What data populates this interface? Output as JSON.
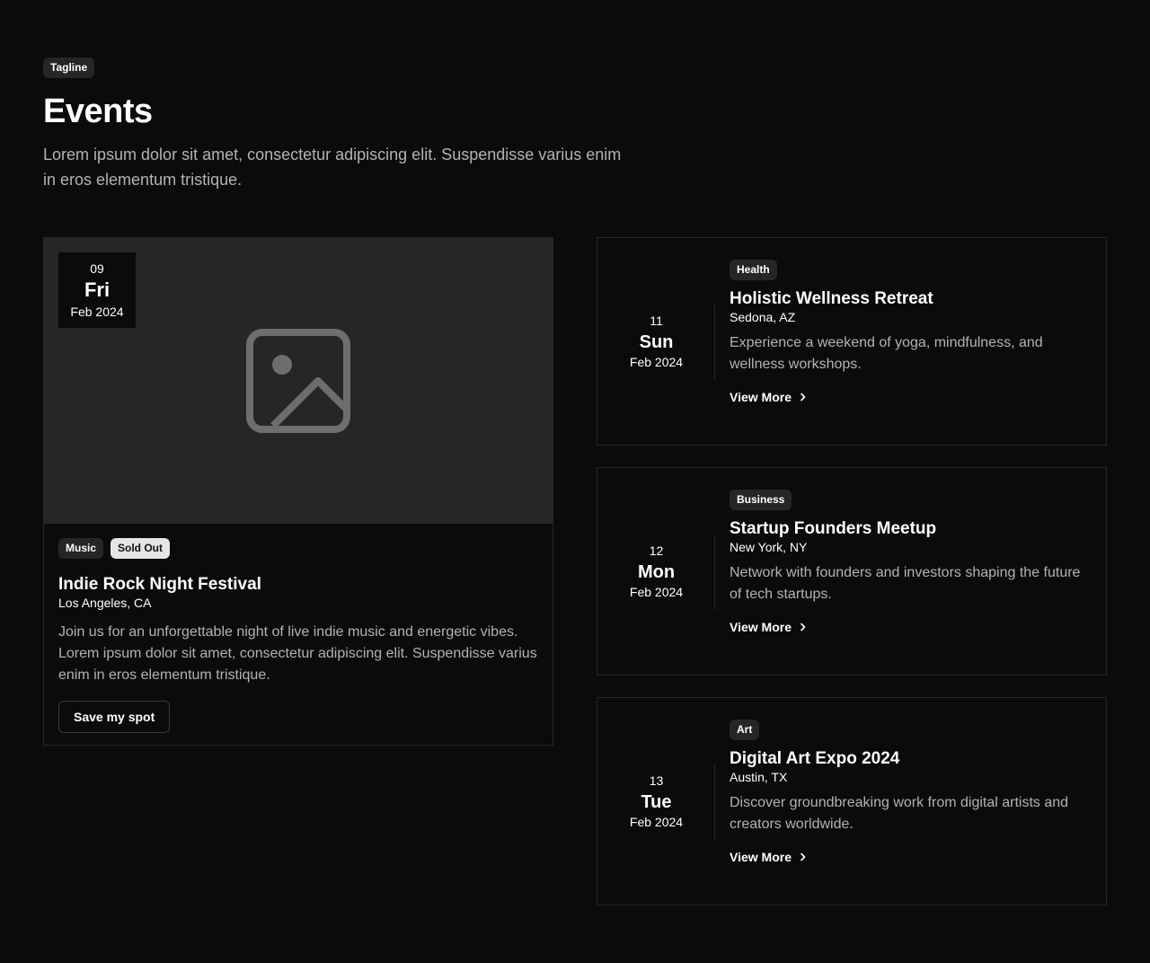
{
  "header": {
    "tagline": "Tagline",
    "title": "Events",
    "description": "Lorem ipsum dolor sit amet, consectetur adipiscing elit. Suspendisse varius enim in eros elementum tristique."
  },
  "featured": {
    "date": {
      "day": "09",
      "weekday": "Fri",
      "month": "Feb 2024"
    },
    "image_icon": "image-placeholder-icon",
    "badges": [
      "Music",
      "Sold Out"
    ],
    "title": "Indie Rock Night Festival",
    "location": "Los Angeles, CA",
    "description": "Join us for an unforgettable night of live indie music and energetic vibes. Lorem ipsum dolor sit amet, consectetur adipiscing elit. Suspendisse varius enim in eros elementum tristique.",
    "button_label": "Save my spot"
  },
  "events": [
    {
      "date": {
        "day": "11",
        "weekday": "Sun",
        "month": "Feb 2024"
      },
      "category": "Health",
      "title": "Holistic Wellness Retreat",
      "location": "Sedona, AZ",
      "description": "Experience a weekend of yoga, mindfulness, and wellness workshops.",
      "link_label": "View More"
    },
    {
      "date": {
        "day": "12",
        "weekday": "Mon",
        "month": "Feb 2024"
      },
      "category": "Business",
      "title": "Startup Founders Meetup",
      "location": "New York, NY",
      "description": "Network with founders and investors shaping the future of tech startups.",
      "link_label": "View More"
    },
    {
      "date": {
        "day": "13",
        "weekday": "Tue",
        "month": "Feb 2024"
      },
      "category": "Art",
      "title": "Digital Art Expo 2024",
      "location": "Austin, TX",
      "description": "Discover groundbreaking work from digital artists and creators worldwide.",
      "link_label": "View More"
    }
  ],
  "colors": {
    "background": "#0b0b0b",
    "surface": "#262626",
    "muted_text": "#b3b3b3",
    "text": "#ffffff"
  }
}
